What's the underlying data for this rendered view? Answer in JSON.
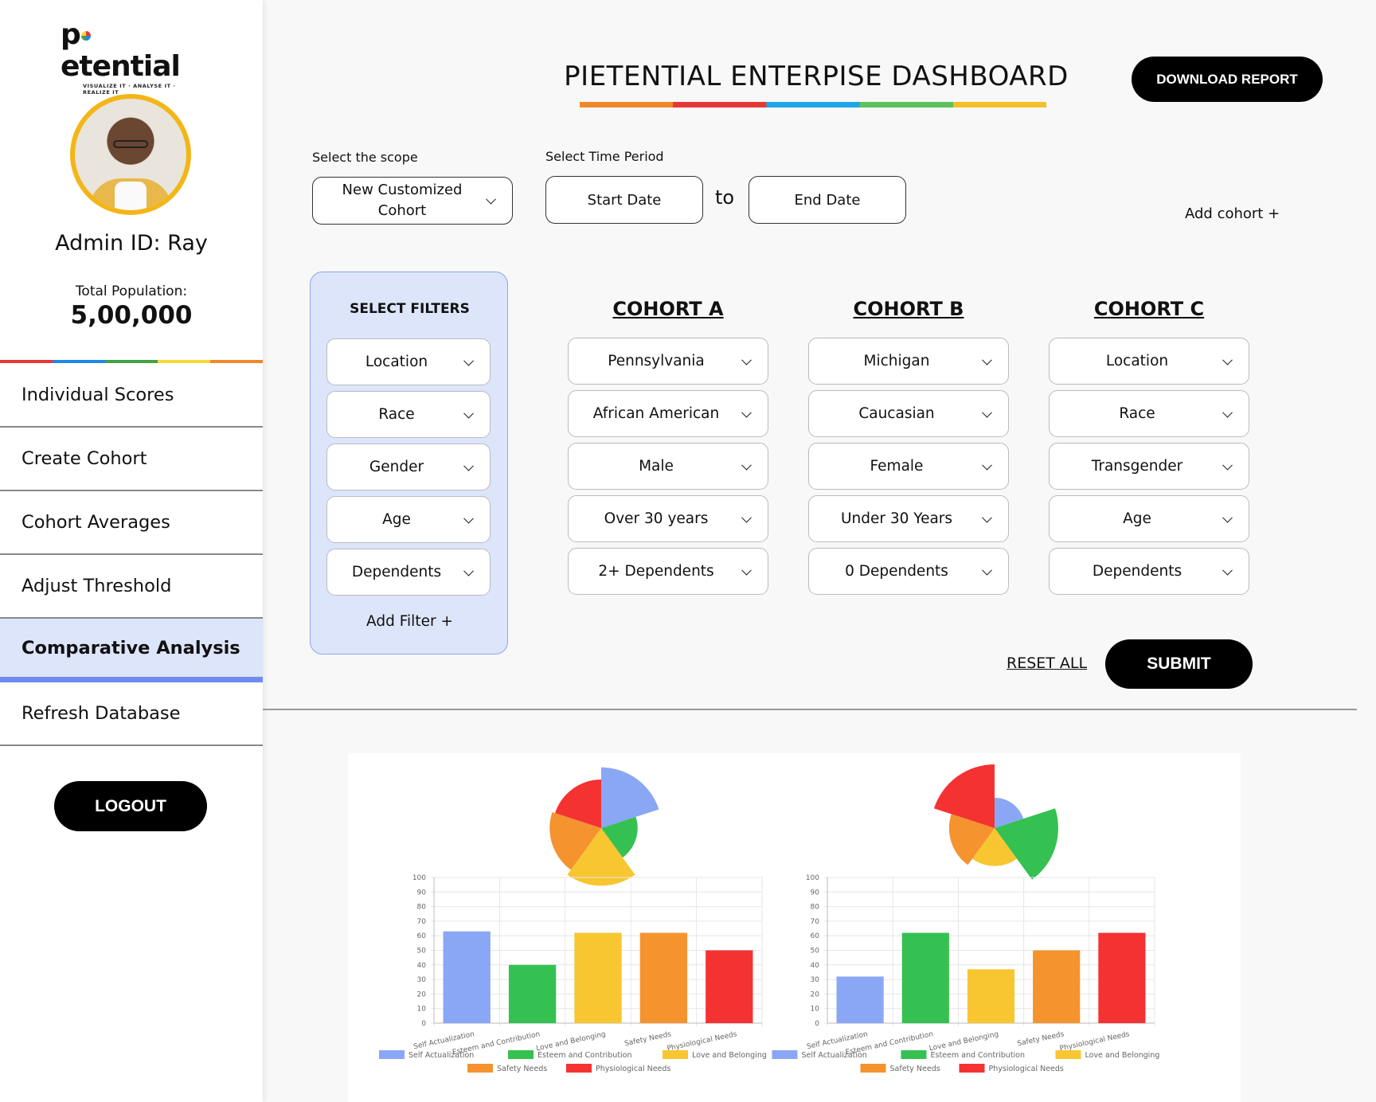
{
  "brand": {
    "name": "pietential",
    "tagline": "VISUALIZE IT · ANALYSE IT · REALIZE IT"
  },
  "profile": {
    "admin_id": "Admin ID: Ray",
    "population_label": "Total Population:",
    "population_value": "5,00,000"
  },
  "nav": {
    "items": [
      {
        "label": "Individual Scores",
        "active": false
      },
      {
        "label": "Create Cohort",
        "active": false
      },
      {
        "label": "Cohort Averages",
        "active": false
      },
      {
        "label": "Adjust Threshold",
        "active": false
      },
      {
        "label": "Comparative Analysis",
        "active": true
      },
      {
        "label": "Refresh Database",
        "active": false
      }
    ],
    "logout": "LOGOUT"
  },
  "header": {
    "title": "PIETENTIAL ENTERPISE DASHBOARD",
    "download": "DOWNLOAD REPORT"
  },
  "scope": {
    "label": "Select the scope",
    "value": "New Customized Cohort"
  },
  "time": {
    "label": "Select Time Period",
    "start": "Start Date",
    "to": "to",
    "end": "End Date"
  },
  "add_cohort": "Add cohort +",
  "filters": {
    "title": "SELECT FILTERS",
    "items": [
      "Location",
      "Race",
      "Gender",
      "Age",
      "Dependents"
    ],
    "add": "Add Filter +"
  },
  "cohorts": [
    {
      "title": "COHORT A",
      "values": [
        "Pennsylvania",
        "African American",
        "Male",
        "Over 30 years",
        "2+ Dependents"
      ]
    },
    {
      "title": "COHORT B",
      "values": [
        "Michigan",
        "Caucasian",
        "Female",
        "Under 30 Years",
        "0 Dependents"
      ]
    },
    {
      "title": "COHORT C",
      "values": [
        "Location",
        "Race",
        "Transgender",
        "Age",
        "Dependents"
      ]
    }
  ],
  "actions": {
    "reset": "RESET ALL",
    "submit": "SUBMIT"
  },
  "colors": {
    "self": "#8aa7f5",
    "esteem": "#35c152",
    "love": "#f7c631",
    "safety": "#f5932f",
    "phys": "#f53232"
  },
  "chart_data": [
    {
      "type": "bar",
      "categories": [
        "Self Actualization",
        "Esteem and Contribution",
        "Love and Belonging",
        "Safety Needs",
        "Physiological Needs"
      ],
      "values": [
        63,
        40,
        62,
        62,
        50
      ],
      "ylim": [
        0,
        100
      ],
      "yticks": [
        0,
        10,
        20,
        30,
        40,
        50,
        60,
        70,
        80,
        90,
        100
      ],
      "legend": [
        "Self Actualization",
        "Esteem and Contribution",
        "Love and Belonging",
        "Safety Needs",
        "Physiological Needs"
      ],
      "polar": {
        "type": "polar-area",
        "values": [
          40,
          24,
          38,
          34,
          32
        ]
      }
    },
    {
      "type": "bar",
      "categories": [
        "Self Actualization",
        "Esteem and Contribution",
        "Love and Belonging",
        "Safety Needs",
        "Physiological Needs"
      ],
      "values": [
        32,
        62,
        37,
        50,
        62
      ],
      "ylim": [
        0,
        100
      ],
      "yticks": [
        0,
        10,
        20,
        30,
        40,
        50,
        60,
        70,
        80,
        90,
        100
      ],
      "legend": [
        "Self Actualization",
        "Esteem and Contribution",
        "Love and Belonging",
        "Safety Needs",
        "Physiological Needs"
      ],
      "polar": {
        "type": "polar-area",
        "values": [
          20,
          42,
          25,
          30,
          42
        ]
      }
    }
  ]
}
